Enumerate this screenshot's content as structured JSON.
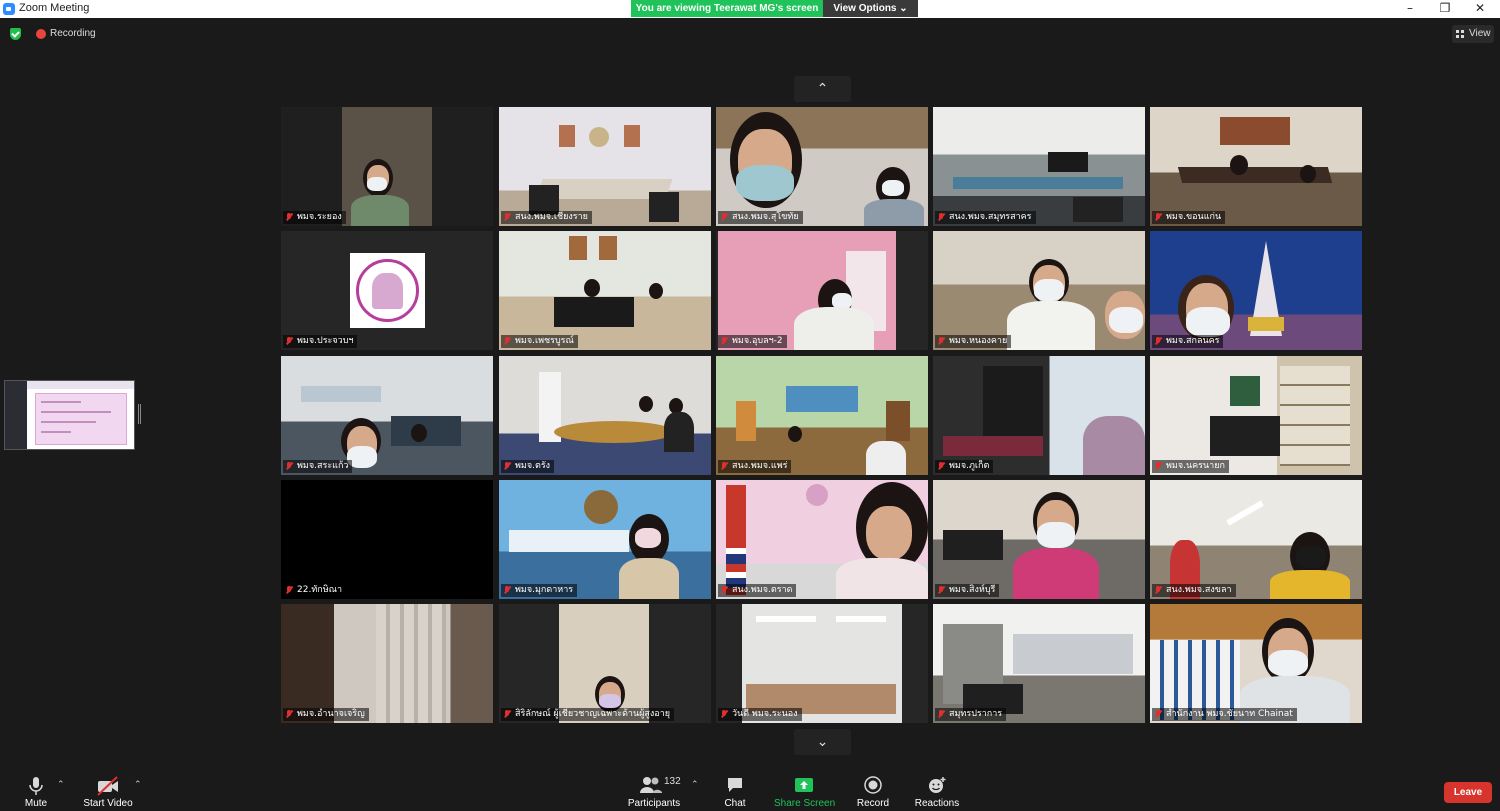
{
  "window": {
    "title": "Zoom Meeting",
    "minimize": "–",
    "restore": "❐",
    "close": "✕"
  },
  "banner": {
    "viewing": "You are viewing Teerawat MG's screen",
    "view_options": "View Options",
    "view_options_caret": "⌄"
  },
  "status": {
    "recording_label": "Recording",
    "view_label": "View"
  },
  "paging": {
    "up": "⌃",
    "down": "⌄"
  },
  "participants": [
    {
      "name": "พมจ.ระยอง",
      "muted": true
    },
    {
      "name": "สนง.พมจ.เชียงราย",
      "muted": true
    },
    {
      "name": "สนง.พมจ.สุโขทัย",
      "muted": true
    },
    {
      "name": "สนง.พมจ.สมุทรสาคร",
      "muted": true
    },
    {
      "name": "พมจ.ขอนแก่น",
      "muted": true
    },
    {
      "name": "พมจ.ประจวบฯ",
      "muted": true
    },
    {
      "name": "พมจ.เพชรบูรณ์",
      "muted": true
    },
    {
      "name": "พมจ.อุบลฯ-2",
      "muted": true
    },
    {
      "name": "พมจ.หนองคาย",
      "muted": true
    },
    {
      "name": "พมจ.สกลนคร",
      "muted": true
    },
    {
      "name": "พมจ.สระแก้ว",
      "muted": true
    },
    {
      "name": "พมจ.ตรัง",
      "muted": true
    },
    {
      "name": "สนง.พมจ.แพร่",
      "muted": true
    },
    {
      "name": "พมจ.ภูเก็ต",
      "muted": true
    },
    {
      "name": "พมจ.นครนายก",
      "muted": true
    },
    {
      "name": "22.ทักษิณา",
      "muted": true
    },
    {
      "name": "พมจ.มุกดาหาร",
      "muted": true
    },
    {
      "name": "สนง.พมจ.ตราด",
      "muted": true
    },
    {
      "name": "พมจ.สิงห์บุรี",
      "muted": true
    },
    {
      "name": "สนง.พมจ.สงขลา",
      "muted": true
    },
    {
      "name": "พมจ.อำนาจเจริญ",
      "muted": true
    },
    {
      "name": "สิริลักษณ์ ผู้เชี่ยวชาญเฉพาะด้านผู้สูงอายุ",
      "muted": true
    },
    {
      "name": "วันดี พมจ.ระนอง",
      "muted": true
    },
    {
      "name": "สมุทรปราการ",
      "muted": true
    },
    {
      "name": "สำนักงาน พมจ.ชัยนาท Chainat",
      "muted": true
    }
  ],
  "toolbar": {
    "mute": "Mute",
    "start_video": "Start Video",
    "participants": "Participants",
    "participants_count": "132",
    "chat": "Chat",
    "share_screen": "Share Screen",
    "record": "Record",
    "reactions": "Reactions",
    "leave": "Leave",
    "caret": "⌃"
  },
  "colors": {
    "share_green": "#20c35a",
    "leave_red": "#d6342c",
    "recording_red": "#e8453c",
    "muted_red": "#e02f2f"
  }
}
